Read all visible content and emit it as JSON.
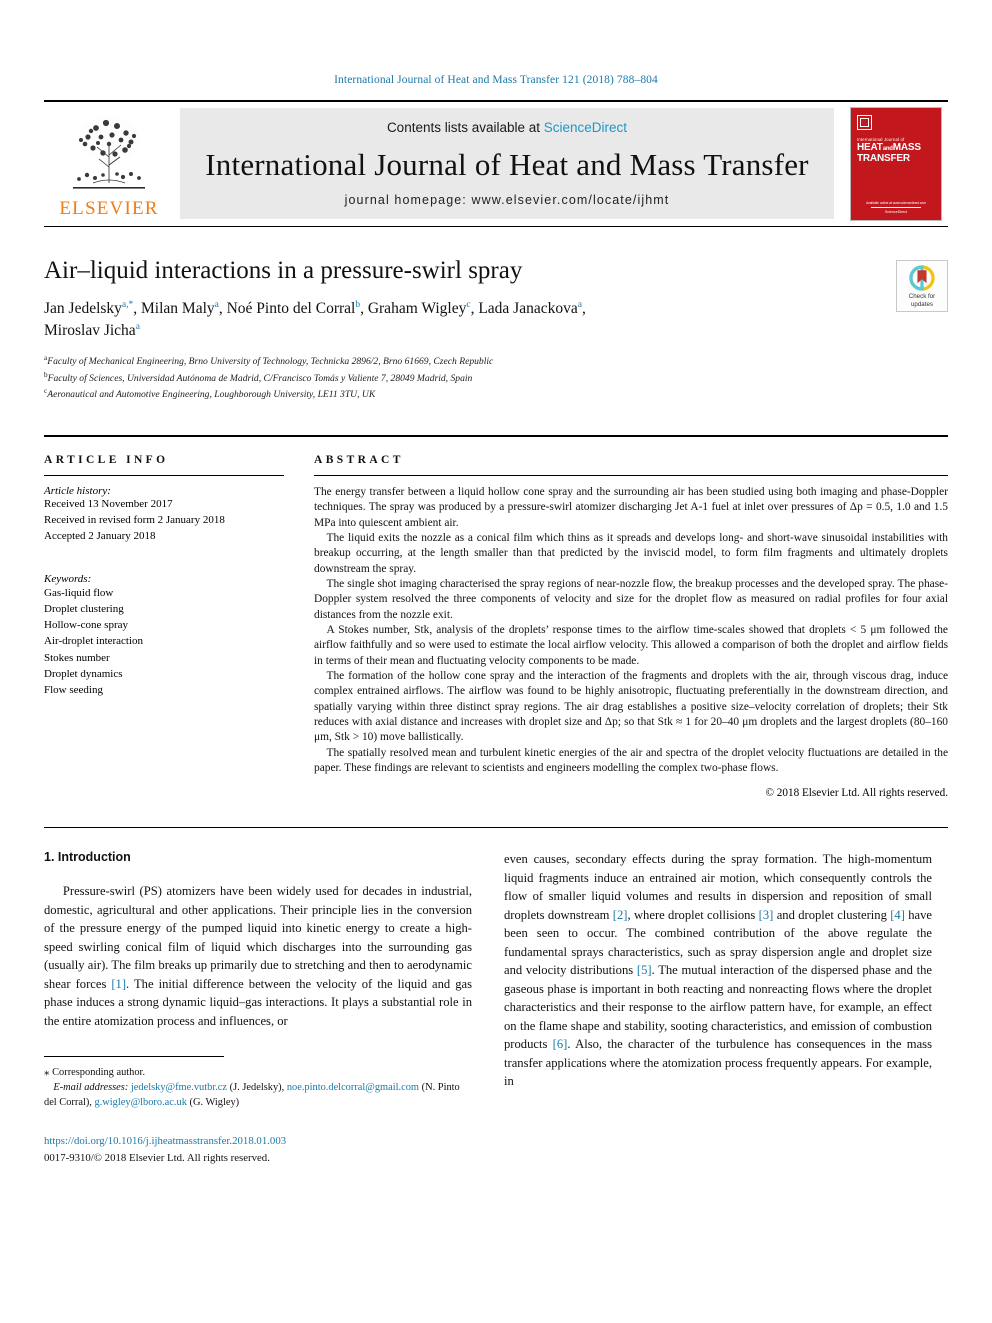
{
  "running_head": "International Journal of Heat and Mass Transfer 121 (2018) 788–804",
  "masthead": {
    "contents_prefix": "Contents lists available at ",
    "sciencedirect": "ScienceDirect",
    "journal_title": "International Journal of Heat and Mass Transfer",
    "homepage": "journal homepage: www.elsevier.com/locate/ijhmt",
    "publisher_word": "ELSEVIER",
    "cover": {
      "small_line": "International Journal of",
      "big_line_1": "HEAT",
      "big_and": "and",
      "big_line_2": "MASS",
      "big_line_3": "TRANSFER",
      "foot_line_1": "Available online at www.sciencedirect.com",
      "foot_line_2": "ScienceDirect"
    }
  },
  "article": {
    "title": "Air–liquid interactions in a pressure-swirl spray",
    "authors_line_1": "Jan Jedelsky ",
    "authors": [
      {
        "name": "Jan Jedelsky",
        "marks": "a,*"
      },
      {
        "name": "Milan Maly",
        "marks": "a"
      },
      {
        "name": "Noé Pinto del Corral",
        "marks": "b"
      },
      {
        "name": "Graham Wigley",
        "marks": "c"
      },
      {
        "name": "Lada Janackova",
        "marks": "a"
      },
      {
        "name": "Miroslav Jicha",
        "marks": "a"
      }
    ],
    "affiliations": [
      {
        "mark": "a",
        "text": "Faculty of Mechanical Engineering, Brno University of Technology, Technicka 2896/2, Brno 61669, Czech Republic"
      },
      {
        "mark": "b",
        "text": "Faculty of Sciences, Universidad Autónoma de Madrid, C/Francisco Tomás y Valiente 7, 28049 Madrid, Spain"
      },
      {
        "mark": "c",
        "text": "Aeronautical and Automotive Engineering, Loughborough University, LE11 3TU, UK"
      }
    ],
    "crossmark_line_1": "Check for",
    "crossmark_line_2": "updates"
  },
  "info": {
    "heading": "ARTICLE INFO",
    "history_label": "Article history:",
    "history": [
      "Received 13 November 2017",
      "Received in revised form 2 January 2018",
      "Accepted 2 January 2018"
    ],
    "keywords_label": "Keywords:",
    "keywords": [
      "Gas-liquid flow",
      "Droplet clustering",
      "Hollow-cone spray",
      "Air-droplet interaction",
      "Stokes number",
      "Droplet dynamics",
      "Flow seeding"
    ]
  },
  "abstract": {
    "heading": "ABSTRACT",
    "paragraphs": [
      "The energy transfer between a liquid hollow cone spray and the surrounding air has been studied using both imaging and phase-Doppler techniques. The spray was produced by a pressure-swirl atomizer discharging Jet A-1 fuel at inlet over pressures of Δp = 0.5, 1.0 and 1.5 MPa into quiescent ambient air.",
      "The liquid exits the nozzle as a conical film which thins as it spreads and develops long- and short-wave sinusoidal instabilities with breakup occurring, at the length smaller than that predicted by the inviscid model, to form film fragments and ultimately droplets downstream the spray.",
      "The single shot imaging characterised the spray regions of near-nozzle flow, the breakup processes and the developed spray. The phase-Doppler system resolved the three components of velocity and size for the droplet flow as measured on radial profiles for four axial distances from the nozzle exit.",
      "A Stokes number, Stk, analysis of the droplets’ response times to the airflow time-scales showed that droplets < 5 μm followed the airflow faithfully and so were used to estimate the local airflow velocity. This allowed a comparison of both the droplet and airflow fields in terms of their mean and fluctuating velocity components to be made.",
      "The formation of the hollow cone spray and the interaction of the fragments and droplets with the air, through viscous drag, induce complex entrained airflows. The airflow was found to be highly anisotropic, fluctuating preferentially in the downstream direction, and spatially varying within three distinct spray regions. The air drag establishes a positive size–velocity correlation of droplets; their Stk reduces with axial distance and increases with droplet size and Δp; so that Stk ≈ 1 for 20–40 μm droplets and the largest droplets (80–160 μm, Stk > 10) move ballistically.",
      "The spatially resolved mean and turbulent kinetic energies of the air and spectra of the droplet velocity fluctuations are detailed in the paper. These findings are relevant to scientists and engineers modelling the complex two-phase flows."
    ],
    "copyright": "© 2018 Elsevier Ltd. All rights reserved."
  },
  "body": {
    "section_title": "1. Introduction",
    "left_paragraph": "Pressure-swirl (PS) atomizers have been widely used for decades in industrial, domestic, agricultural and other applications. Their principle lies in the conversion of the pressure energy of the pumped liquid into kinetic energy to create a high-speed swirling conical film of liquid which discharges into the surrounding gas (usually air). The film breaks up primarily due to stretching and then to aerodynamic shear forces [1]. The initial difference between the velocity of the liquid and gas phase induces a strong dynamic liquid–gas interactions. It plays a substantial role in the entire atomization process and influences, or",
    "right_paragraph": "even causes, secondary effects during the spray formation. The high-momentum liquid fragments induce an entrained air motion, which consequently controls the flow of smaller liquid volumes and results in dispersion and reposition of small droplets downstream [2], where droplet collisions [3] and droplet clustering [4] have been seen to occur. The combined contribution of the above regulate the fundamental sprays characteristics, such as spray dispersion angle and droplet size and velocity distributions [5]. The mutual interaction of the dispersed phase and the gaseous phase is important in both reacting and nonreacting flows where the droplet characteristics and their response to the airflow pattern have, for example, an effect on the flame shape and stability, sooting characteristics, and emission of combustion products [6]. Also, the character of the turbulence has consequences in the mass transfer applications where the atomization process frequently appears. For example, in"
  },
  "footnote": {
    "corresponding": "Corresponding author.",
    "email_label": "E-mail addresses:",
    "emails": [
      {
        "address": "jedelsky@fme.vutbr.cz",
        "owner": "(J. Jedelsky)"
      },
      {
        "address": "noe.pinto.delcorral@gmail.com",
        "owner": "(N. Pinto del Corral)"
      },
      {
        "address": "g.wigley@lboro.ac.uk",
        "owner": "(G. Wigley)"
      }
    ],
    "doi": "https://doi.org/10.1016/j.ijheatmasstransfer.2018.01.003",
    "issn": "0017-9310/© 2018 Elsevier Ltd. All rights reserved."
  },
  "colors": {
    "link": "#1a7aa8",
    "elsevier_orange": "#ef7c1b",
    "cover_red": "#c2171c"
  }
}
